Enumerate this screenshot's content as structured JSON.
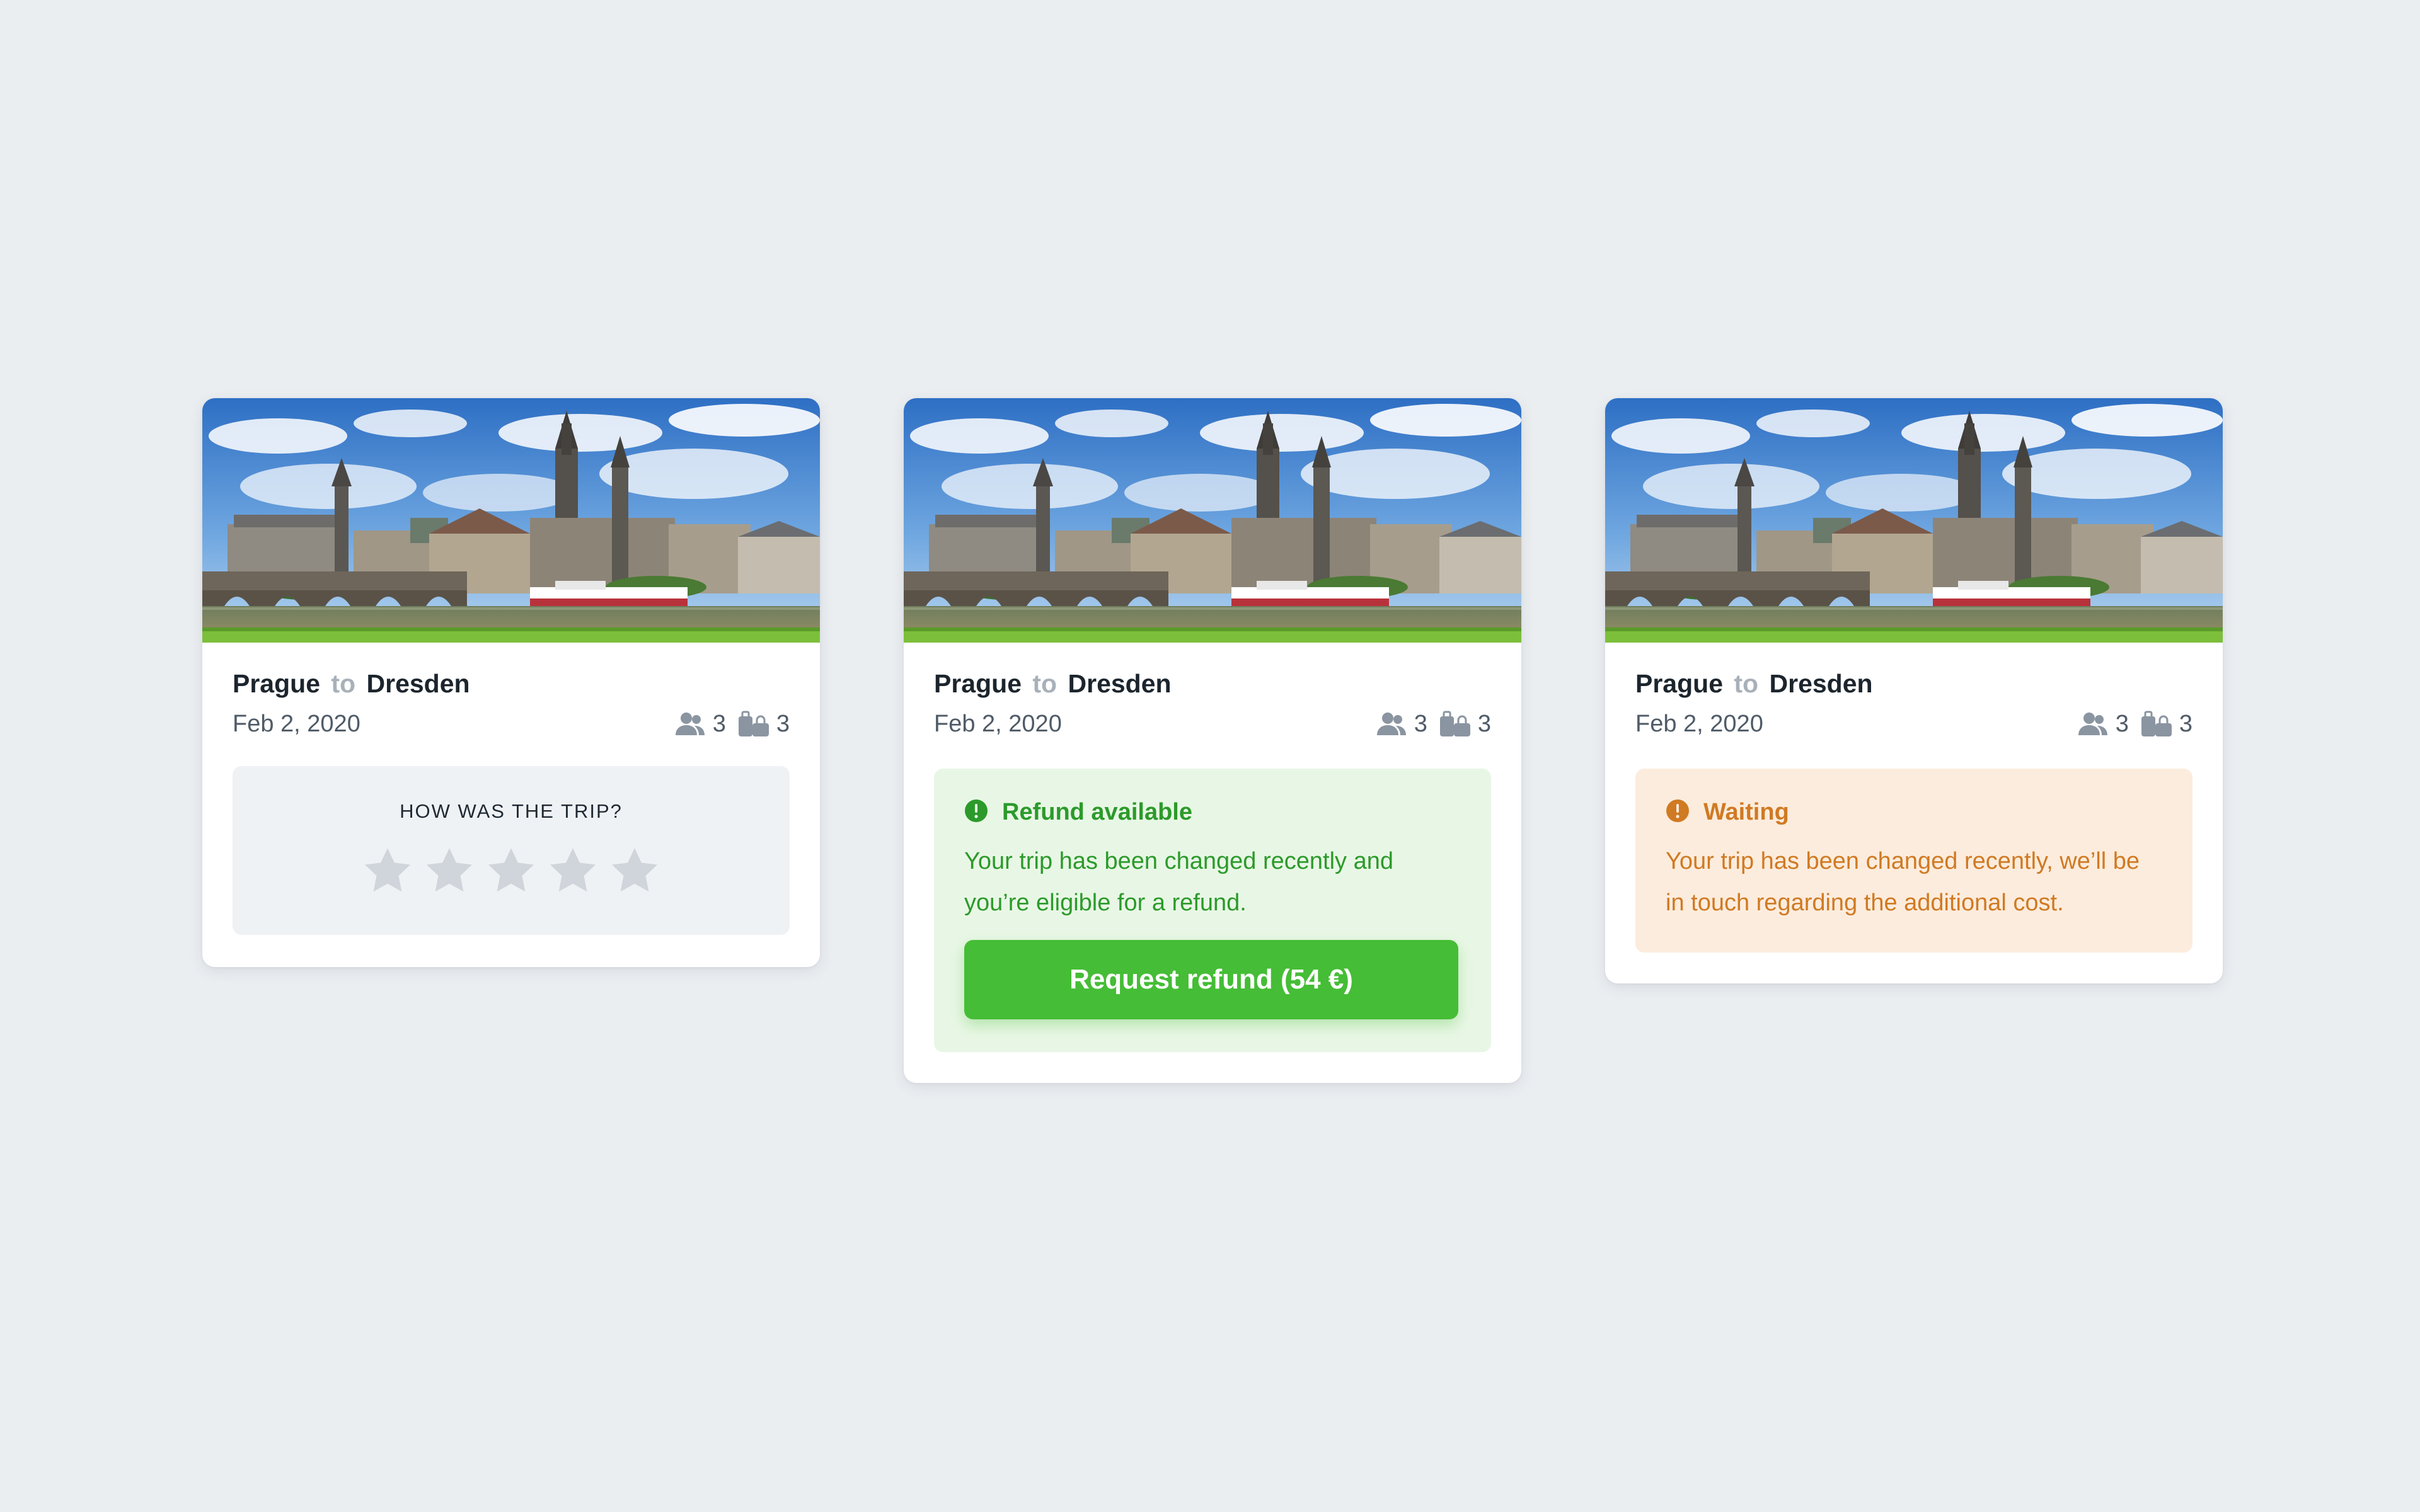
{
  "cards": [
    {
      "from": "Prague",
      "connector": "to",
      "to": "Dresden",
      "date": "Feb 2, 2020",
      "passengers": "3",
      "bags": "3",
      "rating": {
        "title": "HOW WAS THE TRIP?",
        "stars_total": 5,
        "stars_selected": 0
      }
    },
    {
      "from": "Prague",
      "connector": "to",
      "to": "Dresden",
      "date": "Feb 2, 2020",
      "passengers": "3",
      "bags": "3",
      "status": {
        "title": "Refund available",
        "message": "Your trip has been changed recently and you’re eligible for a refund.",
        "button_label": "Request refund (54 €)",
        "color": "#2c9a2b",
        "background": "#e8f7e5",
        "button_color": "#45bd36"
      }
    },
    {
      "from": "Prague",
      "connector": "to",
      "to": "Dresden",
      "date": "Feb 2, 2020",
      "passengers": "3",
      "bags": "3",
      "status": {
        "title": "Waiting",
        "message": "Your trip has been changed recently, we’ll be in touch regarding the additional cost.",
        "color": "#d07a23",
        "background": "#fcecdd"
      }
    }
  ],
  "icons": {
    "passengers": "passengers-icon",
    "bags": "baggage-icon",
    "rating": "star-icon",
    "alert": "alert-icon"
  }
}
